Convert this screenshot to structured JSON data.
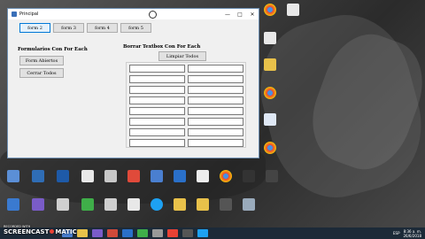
{
  "window": {
    "title": "Principal",
    "tabs": [
      "form 2",
      "form 3",
      "form 4",
      "form 5"
    ],
    "left_group": {
      "heading": "Formularios Con For Each",
      "buttons": [
        "Form Abiertos",
        "Cerrar Todos"
      ]
    },
    "right_group": {
      "heading": "Borrar Textbox Con For Each",
      "clear_button": "Limpiar Todos",
      "textbox_rows": 8
    },
    "controls": {
      "minimize": "—",
      "maximize": "□",
      "close": "✕"
    }
  },
  "desktop": {
    "icon_names": [
      "chrome-icon",
      "folder-icon",
      "document-icon",
      "recycle-bin-icon",
      "app-icon"
    ]
  },
  "taskbar": {
    "watermark": "SCREENCAST",
    "watermark_suffix": "MATIC",
    "watermark_sub": "RECORDED WITH",
    "time": "8:36 a. m.",
    "date": "26/6/2018",
    "language": "ESP"
  },
  "colors": {
    "window_border": "#6d8fb3",
    "focus_accent": "#0078d7",
    "taskbar": "#1c2a38"
  }
}
